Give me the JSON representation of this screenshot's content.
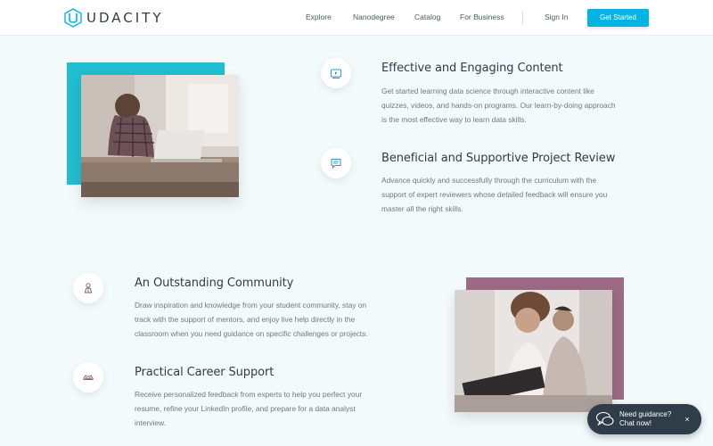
{
  "brand": {
    "name": "UDACITY",
    "accent": "#02b3e4"
  },
  "nav": {
    "links": [
      "Explore",
      "Nanodegree",
      "Catalog",
      "For Business"
    ],
    "sign_in": "Sign In",
    "cta": "Get Started"
  },
  "features": [
    {
      "icon": "video-icon",
      "title": "Effective and Engaging Content",
      "lines": [
        "Get started learning data science through interactive content like",
        "quizzes, videos, and hands-on programs. Our learn-by-doing approach",
        "is the most effective way to learn data skills."
      ]
    },
    {
      "icon": "chat-bubble-icon",
      "title": "Beneficial and Supportive Project Review",
      "lines": [
        "Advance quickly and successfully through the curriculum with the",
        "support of expert reviewers whose detailed feedback will ensure you",
        "master all the right skills."
      ]
    },
    {
      "icon": "person-icon",
      "title": "An Outstanding Community",
      "lines": [
        "Draw inspiration and knowledge from your student community, stay on",
        "track with the support of mentors, and enjoy live help directly in the",
        "classroom when you need guidance on specific challenges or projects."
      ]
    },
    {
      "icon": "handshake-icon",
      "title": "Practical Career Support",
      "lines": [
        "Receive personalized feedback from experts to help you perfect your",
        "resume, refine your LinkedIn profile, and prepare for a data analyst",
        "interview."
      ]
    }
  ],
  "chat": {
    "line1": "Need guidance?",
    "line2": "Chat now!",
    "close": "×"
  },
  "colors": {
    "teal_frame": "#21bdd0",
    "mauve_frame": "#9c6b85",
    "text_dark": "#2e3d49"
  }
}
